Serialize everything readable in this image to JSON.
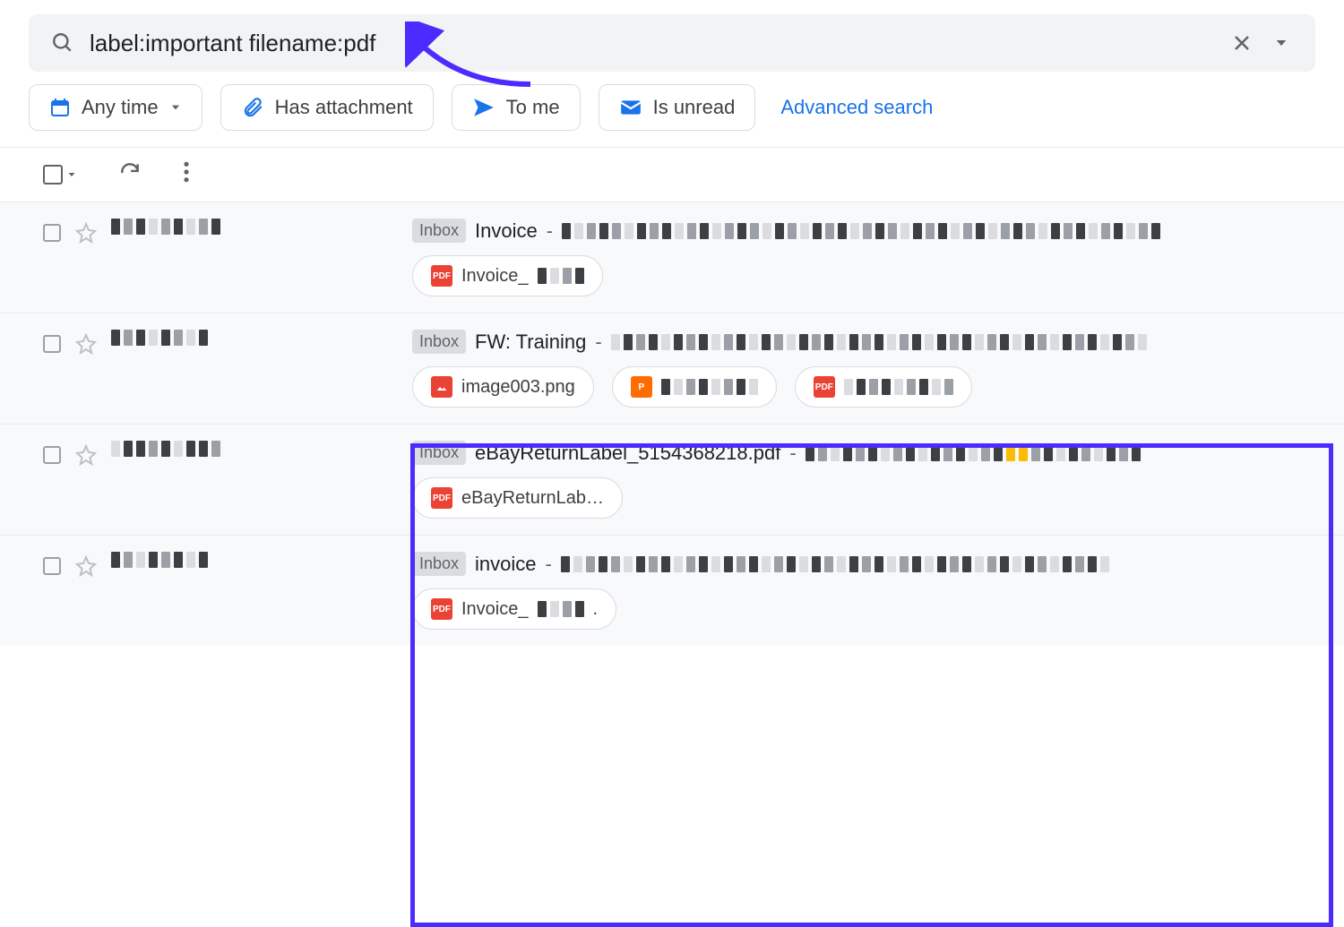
{
  "search": {
    "value": "label:important filename:pdf"
  },
  "filters": {
    "any_time": "Any time",
    "has_attachment": "Has attachment",
    "to_me": "To me",
    "is_unread": "Is unread",
    "advanced": "Advanced search"
  },
  "labels": {
    "inbox": "Inbox"
  },
  "emails": [
    {
      "subject": "Invoice",
      "label": "Inbox",
      "attachments": [
        {
          "type": "pdf",
          "name": "Invoice_"
        }
      ]
    },
    {
      "subject": "FW: Training",
      "label": "Inbox",
      "attachments": [
        {
          "type": "img",
          "name": "image003.png"
        },
        {
          "type": "ppt",
          "name": ""
        },
        {
          "type": "pdf",
          "name": ""
        }
      ]
    },
    {
      "subject": "eBayReturnLabel_5154368218.pdf",
      "label": "Inbox",
      "attachments": [
        {
          "type": "pdf",
          "name": "eBayReturnLab…"
        }
      ]
    },
    {
      "subject": "invoice",
      "label": "Inbox",
      "attachments": [
        {
          "type": "pdf",
          "name": "Invoice_"
        }
      ]
    }
  ],
  "colors": {
    "accent": "#1a73e8",
    "annotation": "#4b2bff"
  }
}
